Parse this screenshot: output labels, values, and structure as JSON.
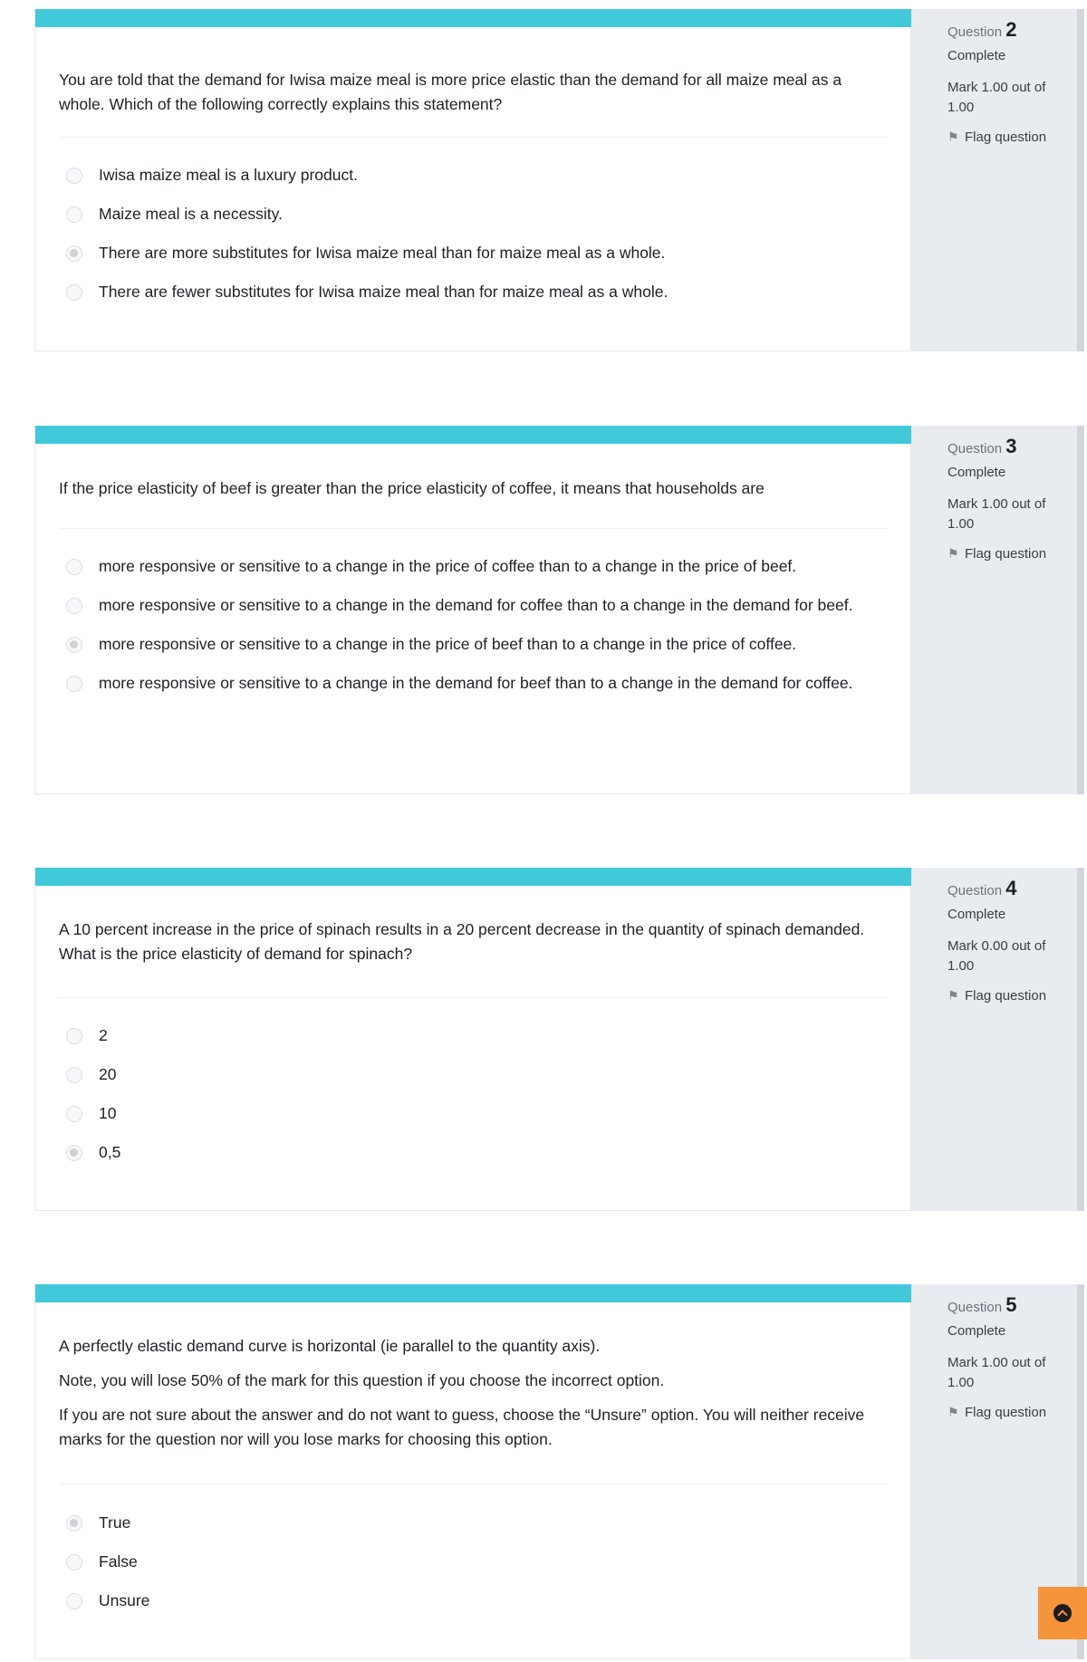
{
  "questions": [
    {
      "label": "Question",
      "number": "2",
      "state": "Complete",
      "grade": "Mark 1.00 out of 1.00",
      "flag_label": "Flag question",
      "text": [
        "You are told that the demand for Iwisa maize meal is more price elastic than the demand for all maize meal as a whole. Which of the following correctly explains this statement?"
      ],
      "options": [
        {
          "label": "Iwisa maize meal is a luxury product.",
          "selected": false
        },
        {
          "label": "Maize meal is a necessity.",
          "selected": false
        },
        {
          "label": "There are more substitutes for Iwisa maize meal than for maize meal as a whole.",
          "selected": true
        },
        {
          "label": "There are fewer substitutes for Iwisa maize meal than for maize meal as a whole.",
          "selected": false
        }
      ]
    },
    {
      "label": "Question",
      "number": "3",
      "state": "Complete",
      "grade": "Mark 1.00 out of 1.00",
      "flag_label": "Flag question",
      "text": [
        "If the price elasticity of beef is greater than the price elasticity of coffee, it means that households are"
      ],
      "options": [
        {
          "label": "more responsive or sensitive to a change in the price of coffee than to a change in the price of beef.",
          "selected": false
        },
        {
          "label": "more responsive or sensitive to a change in the demand for coffee than to a change in the demand for beef.",
          "selected": false
        },
        {
          "label": "more responsive or sensitive to a change in the price of beef than to a change in the price of coffee.",
          "selected": true
        },
        {
          "label": "more responsive or sensitive to a change in the demand for beef than to a change in the demand for coffee.",
          "selected": false
        }
      ]
    },
    {
      "label": "Question",
      "number": "4",
      "state": "Complete",
      "grade": "Mark 0.00 out of 1.00",
      "flag_label": "Flag question",
      "text": [
        "A 10 percent increase in the price of spinach results in a 20 percent decrease in the quantity of spinach demanded. What is the price elasticity of demand for spinach?"
      ],
      "options": [
        {
          "label": "2",
          "selected": false
        },
        {
          "label": "20",
          "selected": false
        },
        {
          "label": "10",
          "selected": false
        },
        {
          "label": "0,5",
          "selected": true
        }
      ]
    },
    {
      "label": "Question",
      "number": "5",
      "state": "Complete",
      "grade": "Mark 1.00 out of 1.00",
      "flag_label": "Flag question",
      "text": [
        "A perfectly elastic demand curve is horizontal (ie parallel to the quantity axis).",
        "Note, you will lose 50% of the mark for this question if you choose the incorrect option.",
        "If you are not sure about the answer and do not want to guess, choose the “Unsure” option. You will neither receive marks for the question nor will you lose marks for choosing this option."
      ],
      "options": [
        {
          "label": "True",
          "selected": true
        },
        {
          "label": "False",
          "selected": false
        },
        {
          "label": "Unsure",
          "selected": false
        }
      ]
    }
  ],
  "back_to_top": {
    "icon": "chevron-up-circle-icon"
  },
  "colors": {
    "accent_bar": "#41c9d9",
    "info_panel": "#e8ebef",
    "back_to_top": "#f5943a"
  }
}
